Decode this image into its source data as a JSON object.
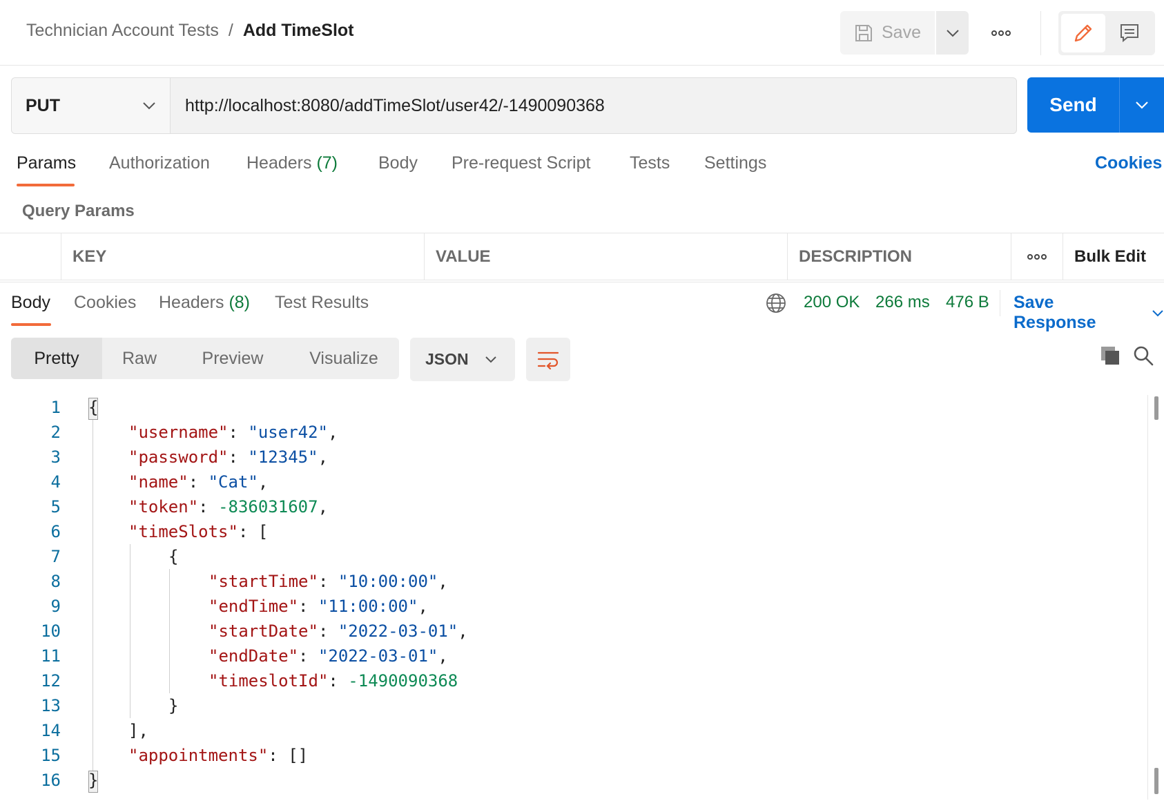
{
  "breadcrumb": {
    "parent": "Technician Account Tests",
    "separator": "/",
    "current": "Add TimeSlot"
  },
  "toolbar": {
    "save_label": "Save"
  },
  "request": {
    "method": "PUT",
    "url": "http://localhost:8080/addTimeSlot/user42/-1490090368",
    "send_label": "Send"
  },
  "request_tabs": [
    {
      "label": "Params"
    },
    {
      "label": "Authorization"
    },
    {
      "label": "Headers",
      "count": "(7)"
    },
    {
      "label": "Body"
    },
    {
      "label": "Pre-request Script"
    },
    {
      "label": "Tests"
    },
    {
      "label": "Settings"
    }
  ],
  "cookies_link": "Cookies",
  "query_params": {
    "title": "Query Params",
    "columns": [
      "KEY",
      "VALUE",
      "DESCRIPTION"
    ],
    "bulk_edit": "Bulk Edit"
  },
  "response_tabs": [
    {
      "label": "Body"
    },
    {
      "label": "Cookies"
    },
    {
      "label": "Headers",
      "count": "(8)"
    },
    {
      "label": "Test Results"
    }
  ],
  "response_status": {
    "status": "200 OK",
    "time": "266 ms",
    "size": "476 B"
  },
  "save_response": "Save Response",
  "view_modes": [
    "Pretty",
    "Raw",
    "Preview",
    "Visualize"
  ],
  "format": "JSON",
  "colors": {
    "accent": "#f26b3a",
    "primary": "#0a73e0",
    "link": "#0b6bcb",
    "status_ok": "#0d7a3a",
    "json_key": "#a31515",
    "json_string": "#0b4fa3",
    "json_number": "#0e8a55"
  },
  "icons": {
    "save": "floppy-disk-icon",
    "more": "ellipsis-icon",
    "edit": "pencil-icon",
    "comment": "comment-icon",
    "globe": "globe-icon",
    "wrap": "wrap-lines-icon",
    "copy": "copy-icon",
    "search": "search-icon"
  },
  "body_lines": [
    {
      "n": "1",
      "text": "{"
    },
    {
      "n": "2",
      "indent": 1,
      "key": "\"username\"",
      "val": "\"user42\"",
      "vt": "s",
      "tail": ","
    },
    {
      "n": "3",
      "indent": 1,
      "key": "\"password\"",
      "val": "\"12345\"",
      "vt": "s",
      "tail": ","
    },
    {
      "n": "4",
      "indent": 1,
      "key": "\"name\"",
      "val": "\"Cat\"",
      "vt": "s",
      "tail": ","
    },
    {
      "n": "5",
      "indent": 1,
      "key": "\"token\"",
      "val": "-836031607",
      "vt": "n",
      "tail": ","
    },
    {
      "n": "6",
      "indent": 1,
      "key": "\"timeSlots\"",
      "val": "[",
      "vt": "p",
      "tail": ""
    },
    {
      "n": "7",
      "indent": 2,
      "text": "{"
    },
    {
      "n": "8",
      "indent": 3,
      "key": "\"startTime\"",
      "val": "\"10:00:00\"",
      "vt": "s",
      "tail": ","
    },
    {
      "n": "9",
      "indent": 3,
      "key": "\"endTime\"",
      "val": "\"11:00:00\"",
      "vt": "s",
      "tail": ","
    },
    {
      "n": "10",
      "indent": 3,
      "key": "\"startDate\"",
      "val": "\"2022-03-01\"",
      "vt": "s",
      "tail": ","
    },
    {
      "n": "11",
      "indent": 3,
      "key": "\"endDate\"",
      "val": "\"2022-03-01\"",
      "vt": "s",
      "tail": ","
    },
    {
      "n": "12",
      "indent": 3,
      "key": "\"timeslotId\"",
      "val": "-1490090368",
      "vt": "n",
      "tail": ""
    },
    {
      "n": "13",
      "indent": 2,
      "text": "}"
    },
    {
      "n": "14",
      "indent": 1,
      "text": "],"
    },
    {
      "n": "15",
      "indent": 1,
      "key": "\"appointments\"",
      "val": "[]",
      "vt": "p",
      "tail": ""
    },
    {
      "n": "16",
      "text": "}"
    }
  ]
}
